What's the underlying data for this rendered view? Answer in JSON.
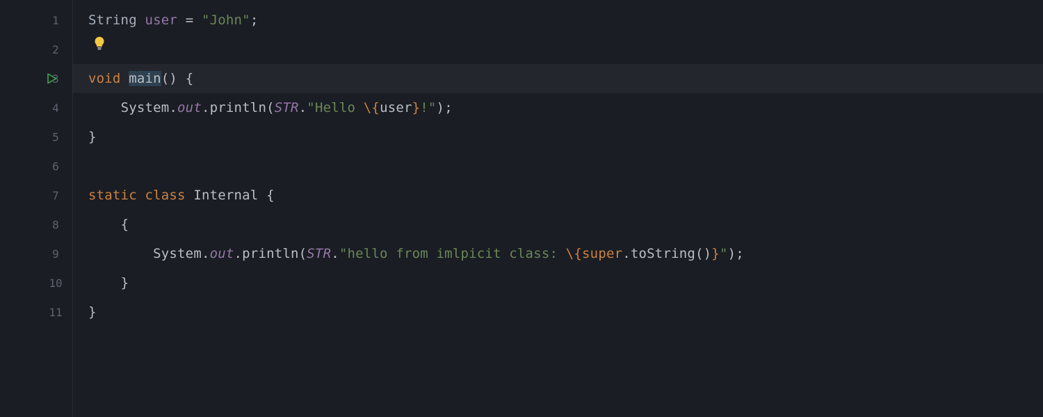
{
  "lines": {
    "1": "1",
    "2": "2",
    "3": "3",
    "4": "4",
    "5": "5",
    "6": "6",
    "7": "7",
    "8": "8",
    "9": "9",
    "10": "10",
    "11": "11"
  },
  "code": {
    "l1": {
      "t1": "String",
      "sp1": " ",
      "t2": "user",
      "sp2": " ",
      "eq": "=",
      "sp3": " ",
      "q1": "\"",
      "s1": "John",
      "q2": "\"",
      "semi": ";"
    },
    "l3": {
      "kw": "void",
      "sp1": " ",
      "sel_m": "m",
      "caret": "",
      "sel_ain": "ain",
      "par": "()",
      "sp2": " ",
      "brace": "{"
    },
    "l4": {
      "indent": "    ",
      "sys": "System",
      "dot1": ".",
      "out": "out",
      "dot2": ".",
      "println": "println",
      "op": "(",
      "str": "STR",
      "dot3": ".",
      "q1": "\"",
      "hello": "Hello ",
      "esc1": "\\{",
      "user": "user",
      "esc2": "}",
      "bang": "!",
      "q2": "\"",
      "cp": ")",
      "semi": ";"
    },
    "l5": {
      "brace": "}"
    },
    "l7": {
      "kw1": "static",
      "sp1": " ",
      "kw2": "class",
      "sp2": " ",
      "name": "Internal",
      "sp3": " ",
      "brace": "{"
    },
    "l8": {
      "indent": "    ",
      "brace": "{"
    },
    "l9": {
      "indent": "        ",
      "sys": "System",
      "dot1": ".",
      "out": "out",
      "dot2": ".",
      "println": "println",
      "op": "(",
      "str": "STR",
      "dot3": ".",
      "q1": "\"",
      "hello": "hello from imlpicit class: ",
      "esc1": "\\{",
      "super": "super",
      "dot4": ".",
      "tos": "toString",
      "par": "()",
      "esc2": "}",
      "q2": "\"",
      "cp": ")",
      "semi": ";"
    },
    "l10": {
      "indent": "    ",
      "brace": "}"
    },
    "l11": {
      "brace": "}"
    }
  }
}
